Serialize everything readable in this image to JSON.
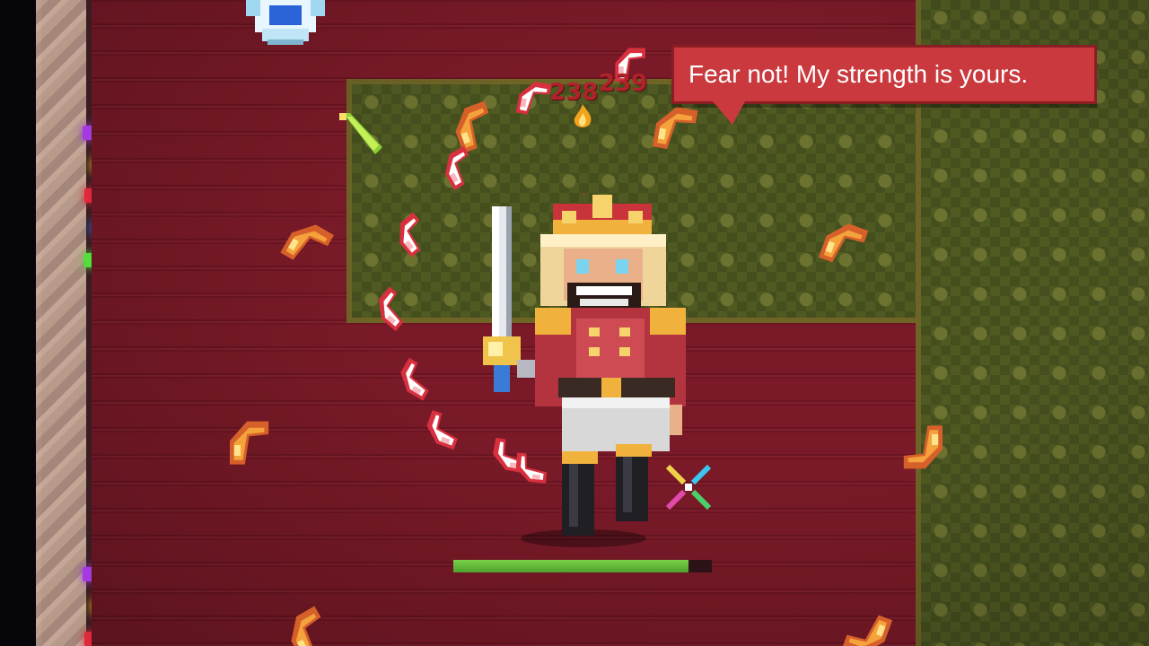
{
  "dialogue": {
    "text": "Fear not! My strength is yours."
  },
  "damage_numbers": [
    "238",
    "239"
  ],
  "player": {
    "health_fraction": 0.91
  },
  "colors": {
    "bubble": "#c9393d",
    "health": "#5cb83a",
    "floor": "#7a1a28",
    "carpet": "#4f5a22"
  },
  "icons": [
    "ally-crystal-icon",
    "sword-icon",
    "boomerang-icon",
    "crosshair-icon",
    "green-potion-icon",
    "flame-icon"
  ]
}
